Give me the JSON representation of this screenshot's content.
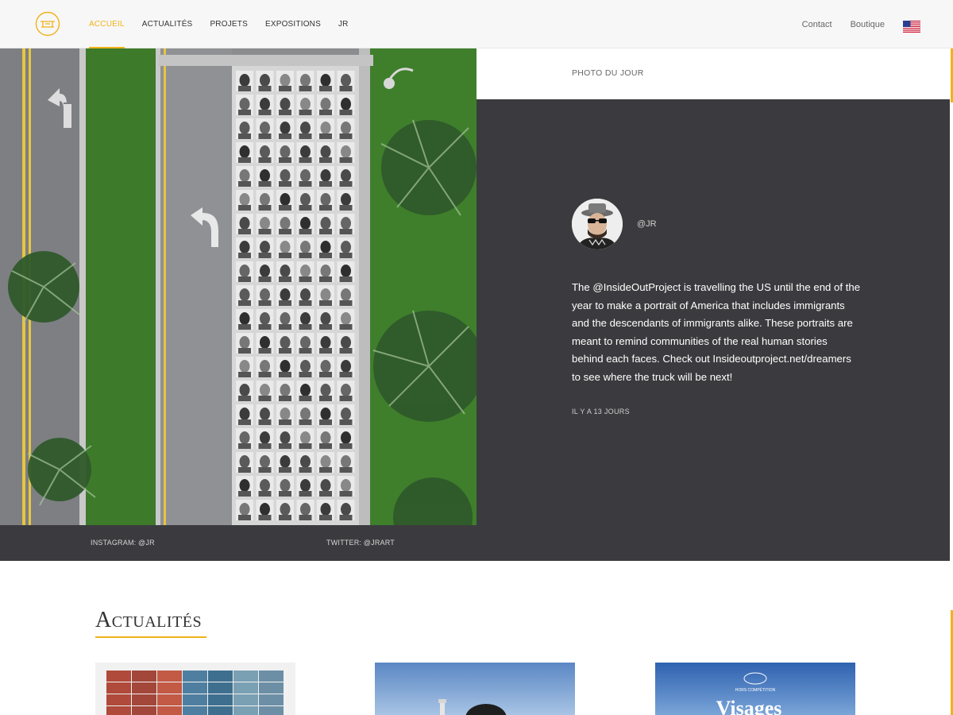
{
  "header": {
    "logo_icon": "jr-logo-icon",
    "nav": [
      {
        "label": "ACCUEIL",
        "active": true
      },
      {
        "label": "ACTUALITÉS",
        "active": false
      },
      {
        "label": "PROJETS",
        "active": false
      },
      {
        "label": "EXPOSITIONS",
        "active": false
      },
      {
        "label": "JR",
        "active": false
      }
    ],
    "contact_label": "Contact",
    "shop_label": "Boutique",
    "flag_icon": "us-flag-icon"
  },
  "hero": {
    "caption": "PHOTO DU JOUR",
    "handle": "@JR",
    "text": "The @InsideOutProject is travelling the US until the end of the year to make a portrait of America that includes immigrants and the descendants of immigrants alike. These portraits are meant to remind communities of the real human stories behind each faces. Check out Insideoutproject.net/dreamers to see where the truck will be next!",
    "time_ago": "IL Y A 13 JOURS",
    "instagram_label": "INSTAGRAM: @JR",
    "twitter_label": "TWITTER: @JRART"
  },
  "news": {
    "title": "Actualités",
    "cards": [
      {
        "image": "shipping-containers-image"
      },
      {
        "image": "portrait-sky-image"
      },
      {
        "image": "visages-villages-poster-image",
        "overlay_title": "Visages",
        "overlay_badge": "HORS COMPÉTITION"
      }
    ]
  },
  "colors": {
    "accent": "#f0b21a",
    "dark_panel": "#3b3b3f",
    "header_bg": "#f7f7f7"
  }
}
